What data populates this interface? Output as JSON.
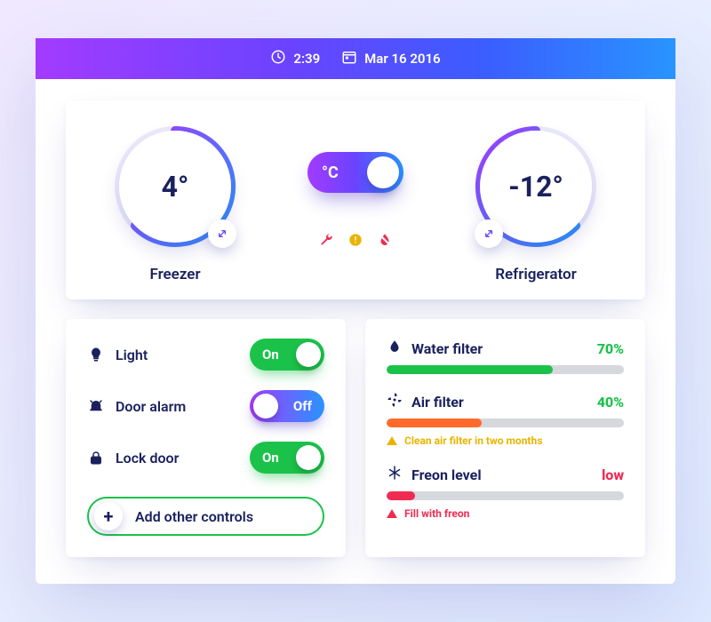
{
  "header": {
    "time": "2:39",
    "date": "Mar 16 2016"
  },
  "temps": {
    "unit_label": "°C",
    "freezer": {
      "value": "4°",
      "label": "Freezer"
    },
    "fridge": {
      "value": "-12°",
      "label": "Refrigerator"
    }
  },
  "alert_icons": [
    "wrench",
    "warning",
    "water-off"
  ],
  "controls": {
    "items": [
      {
        "icon": "lightbulb",
        "label": "Light",
        "state": "on",
        "text": "On"
      },
      {
        "icon": "bell-alarm",
        "label": "Door alarm",
        "state": "off",
        "text": "Off"
      },
      {
        "icon": "lock",
        "label": "Lock door",
        "state": "on",
        "text": "On"
      }
    ],
    "add_label": "Add other controls"
  },
  "status": {
    "items": [
      {
        "icon": "drop",
        "label": "Water filter",
        "value": "70%",
        "pct": 70,
        "color": "#1bc24a",
        "value_class": "green"
      },
      {
        "icon": "fan",
        "label": "Air filter",
        "value": "40%",
        "pct": 40,
        "color": "#ff6a2b",
        "value_class": "green",
        "note": {
          "text": "Clean air filter in two months",
          "color": "#e8b400",
          "tri": "#e8b400"
        }
      },
      {
        "icon": "snow",
        "label": "Freon level",
        "value": "low",
        "pct": 12,
        "color": "#ef2b52",
        "value_class": "red",
        "note": {
          "text": "Fill with freon",
          "color": "#ef2b52",
          "tri": "#ef2b52"
        }
      }
    ]
  },
  "colors": {
    "accent_purple": "#a23bff",
    "accent_blue": "#2994ff",
    "ok": "#1bc24a",
    "warn": "#e8b400",
    "bad": "#ef2b52"
  }
}
